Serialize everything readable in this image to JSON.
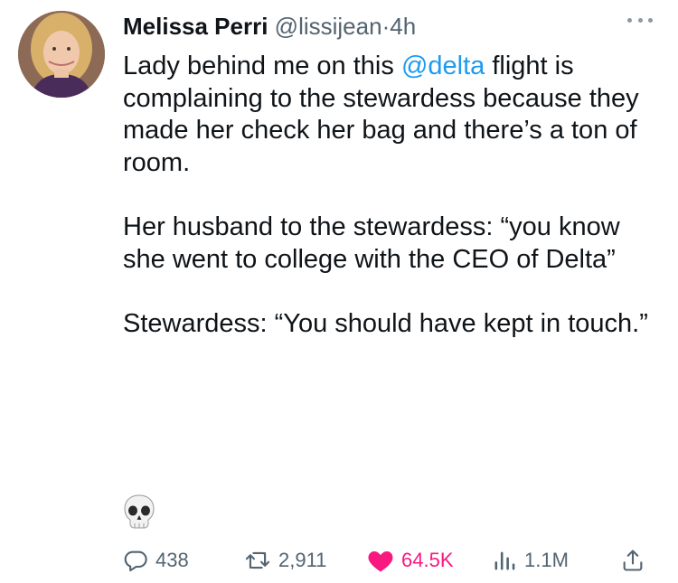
{
  "author": {
    "name": "Melissa Perri",
    "handle": "@lissijean",
    "separator": "·",
    "time": "4h"
  },
  "tweet": {
    "p1_before": "Lady behind me on this ",
    "p1_mention": "@delta",
    "p1_after": " flight is complaining to the stewardess because they made her check her bag and there’s a ton of room.",
    "p2": "Her husband to the stewardess: “you know she went to college with the CEO of Delta”",
    "p3": "Stewardess: “You should have kept in touch.”",
    "emoji": "skull-emoji"
  },
  "actions": {
    "replies": "438",
    "retweets": "2,911",
    "likes": "64.5K",
    "views": "1.1M"
  },
  "icons": {
    "reply": "reply-icon",
    "retweet": "retweet-icon",
    "like": "heart-icon",
    "views": "views-icon",
    "share": "share-icon",
    "more": "more-icon"
  },
  "colors": {
    "text": "#0f1419",
    "secondary": "#536471",
    "mention": "#1d9bf0",
    "like": "#f91880"
  }
}
